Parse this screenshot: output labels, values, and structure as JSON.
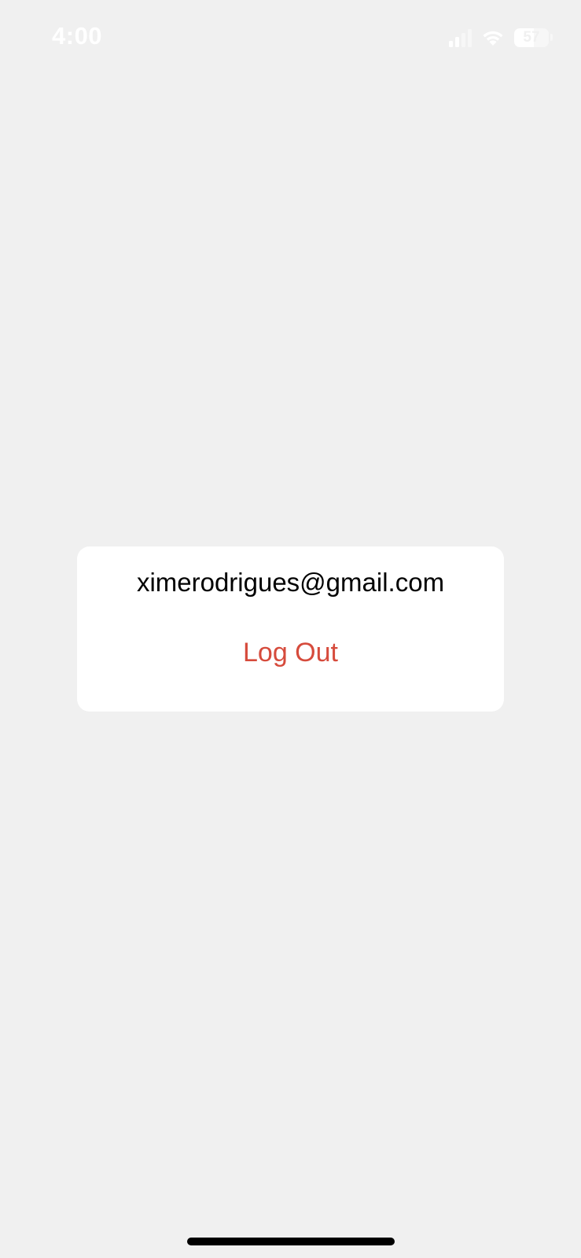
{
  "status_bar": {
    "time": "4:00",
    "battery_level": "57",
    "battery_fraction": 0.57,
    "icons": [
      "signal-icon",
      "wifi-icon",
      "battery-icon"
    ]
  },
  "account": {
    "email": "ximerodrigues@gmail.com",
    "logout_label": "Log Out"
  },
  "colors": {
    "background": "#f0f0f0",
    "card": "#ffffff",
    "logout": "#d64b3c",
    "text": "#000000"
  }
}
